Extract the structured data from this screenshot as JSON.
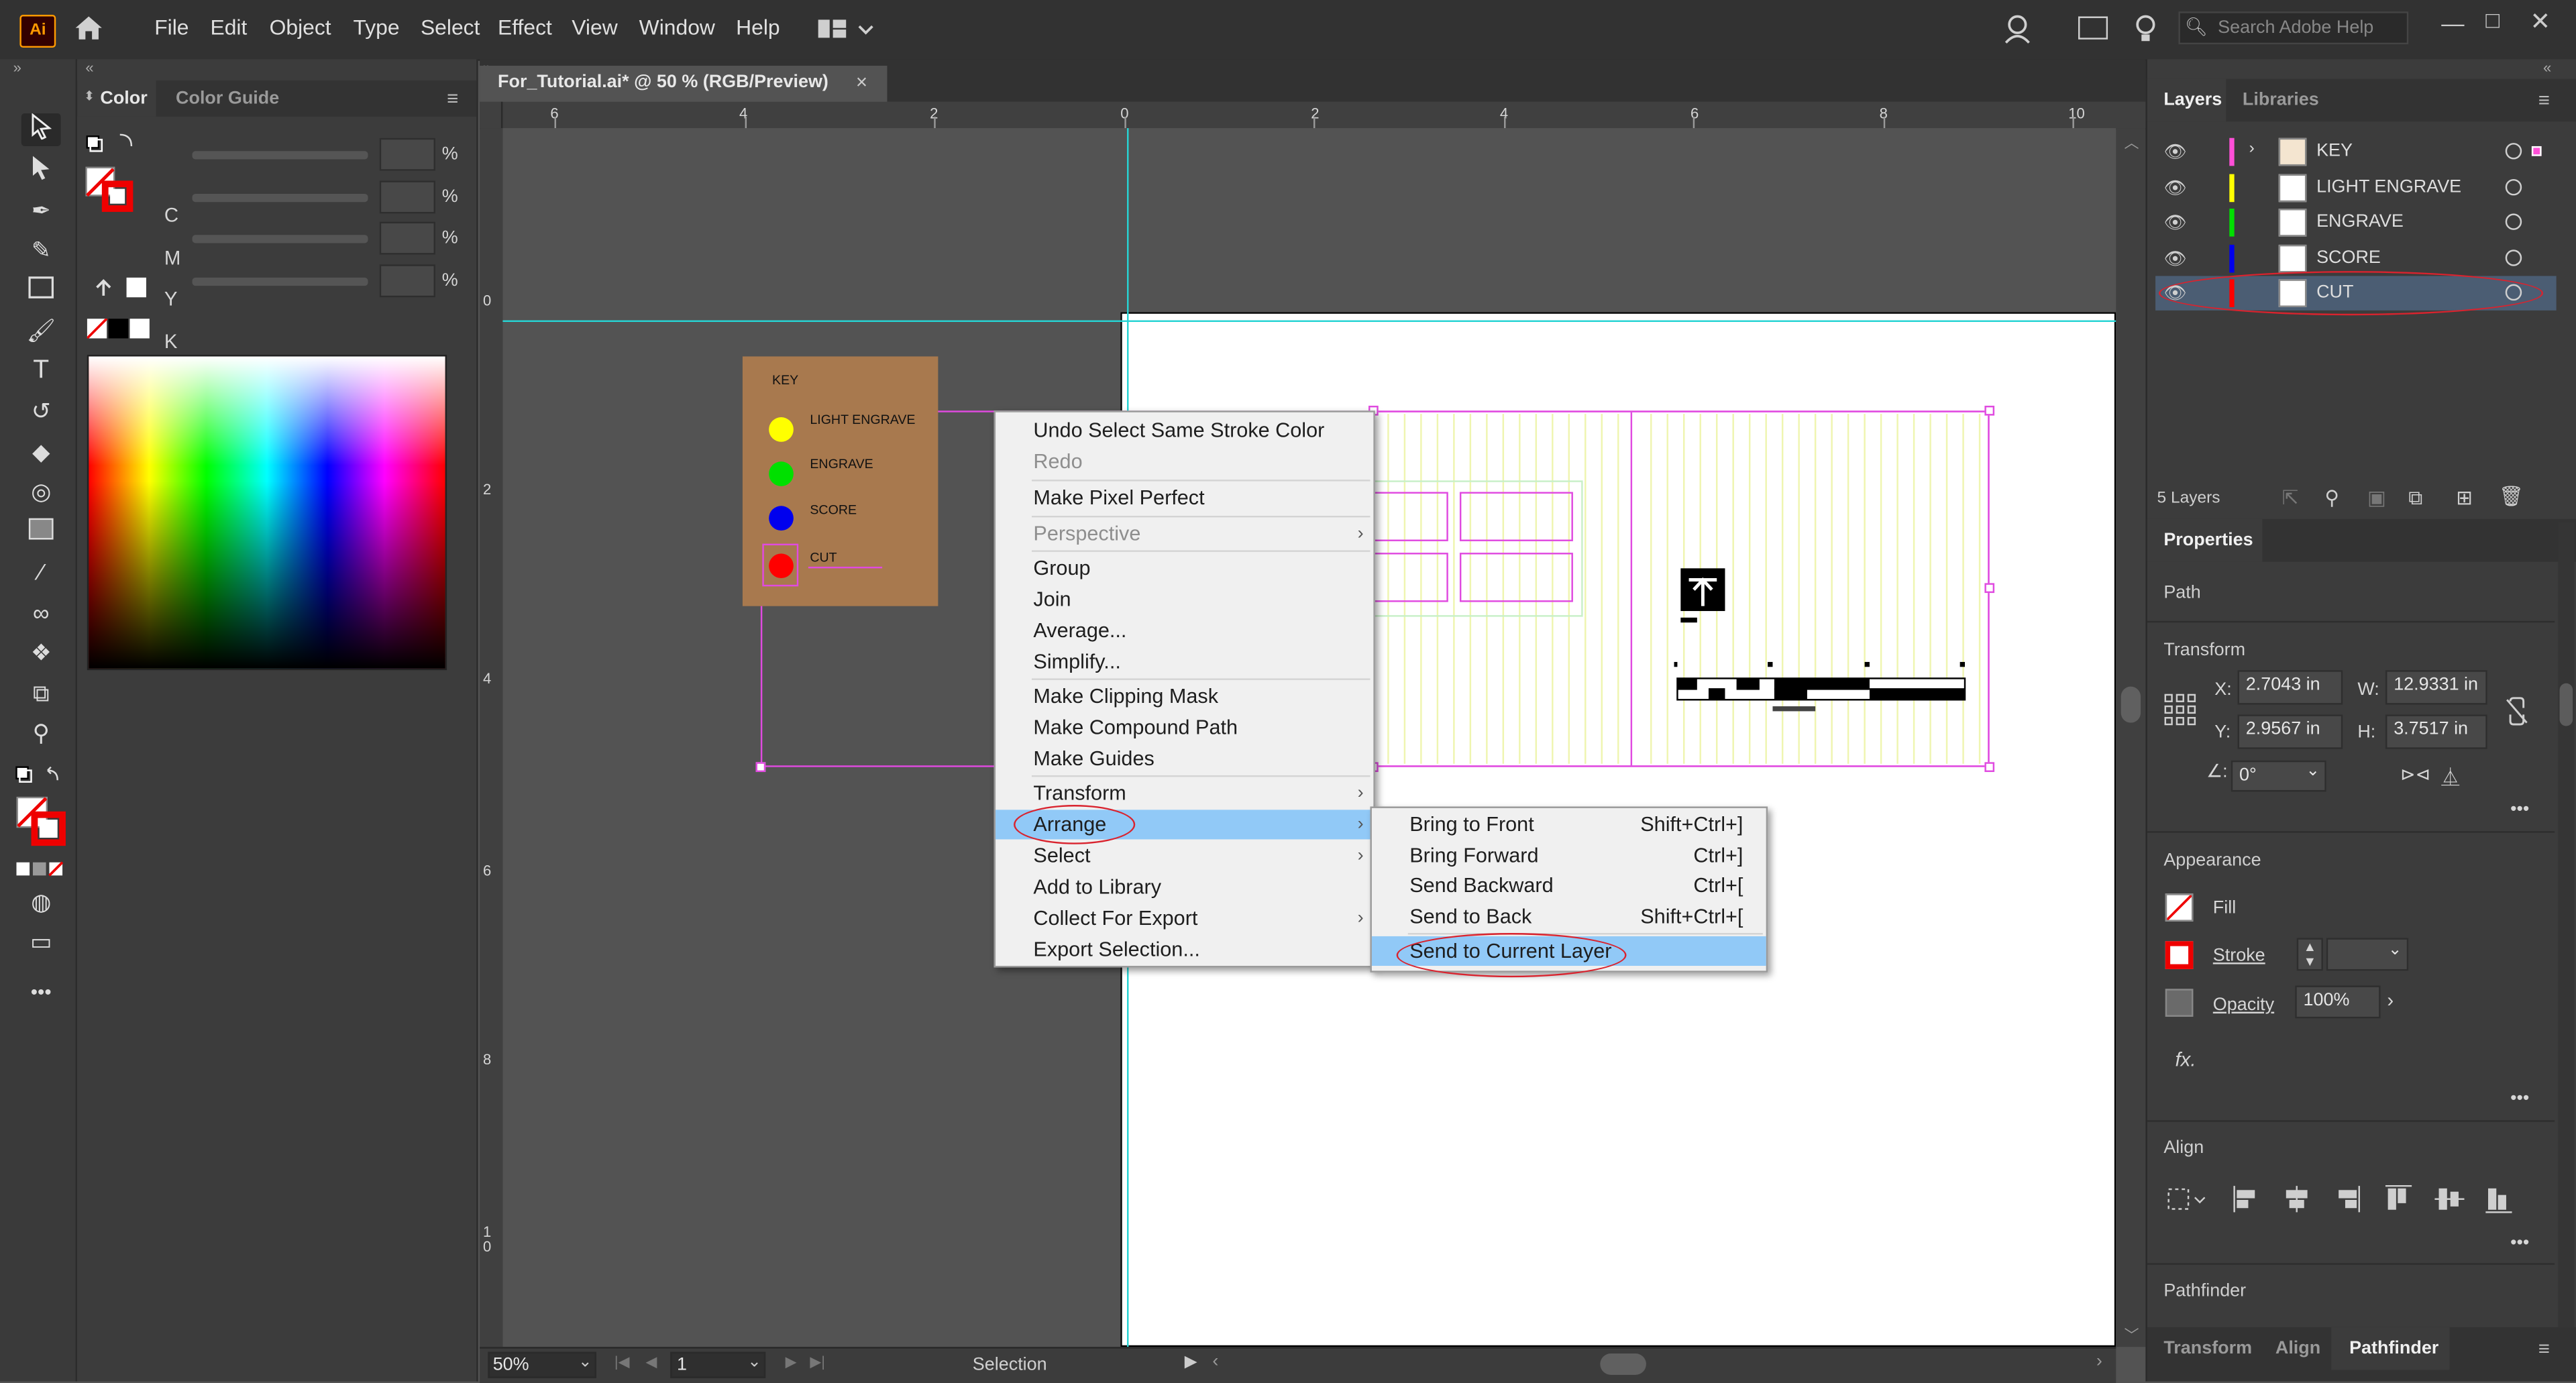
{
  "app": {
    "logo": "Ai",
    "icons": [
      "home-icon",
      "workspace-icon",
      "profile-icon",
      "panel-icon",
      "lightbulb-icon"
    ]
  },
  "menu": [
    "File",
    "Edit",
    "Object",
    "Type",
    "Select",
    "Effect",
    "View",
    "Window",
    "Help"
  ],
  "search": {
    "placeholder": "Search Adobe Help"
  },
  "document_tab": {
    "title": "For_Tutorial.ai* @ 50 % (RGB/Preview)",
    "close": "×"
  },
  "color_panel": {
    "tabs": [
      "Color",
      "Color Guide"
    ],
    "channels": [
      {
        "label": "C",
        "value": "",
        "unit": "%"
      },
      {
        "label": "M",
        "value": "",
        "unit": "%"
      },
      {
        "label": "Y",
        "value": "",
        "unit": "%"
      },
      {
        "label": "K",
        "value": "",
        "unit": "%"
      }
    ]
  },
  "ruler": {
    "horizontal": [
      "6",
      "4",
      "2",
      "0",
      "2",
      "4",
      "6",
      "8",
      "10"
    ],
    "vertical": [
      "0",
      "2",
      "4",
      "6",
      "8",
      "1\n0"
    ]
  },
  "key_panel": {
    "title": "KEY",
    "items": [
      {
        "label": "LIGHT ENGRAVE",
        "color": "#ffff00"
      },
      {
        "label": "ENGRAVE",
        "color": "#00e000"
      },
      {
        "label": "SCORE",
        "color": "#0000ee"
      },
      {
        "label": "CUT",
        "color": "#ff0000"
      }
    ]
  },
  "context_menu": {
    "items": [
      {
        "label": "Undo Select Same Stroke Color",
        "disabled": false
      },
      {
        "label": "Redo",
        "disabled": true
      },
      {
        "label": "Make Pixel Perfect",
        "disabled": false
      },
      {
        "label": "Perspective",
        "disabled": true,
        "submenu": true
      },
      {
        "label": "Group",
        "disabled": false
      },
      {
        "label": "Join",
        "disabled": false
      },
      {
        "label": "Average...",
        "disabled": false
      },
      {
        "label": "Simplify...",
        "disabled": false
      },
      {
        "label": "Make Clipping Mask",
        "disabled": false
      },
      {
        "label": "Make Compound Path",
        "disabled": false
      },
      {
        "label": "Make Guides",
        "disabled": false
      },
      {
        "label": "Transform",
        "disabled": false,
        "submenu": true
      },
      {
        "label": "Arrange",
        "disabled": false,
        "submenu": true,
        "highlighted": true
      },
      {
        "label": "Select",
        "disabled": false,
        "submenu": true
      },
      {
        "label": "Add to Library",
        "disabled": false
      },
      {
        "label": "Collect For Export",
        "disabled": false,
        "submenu": true
      },
      {
        "label": "Export Selection...",
        "disabled": false
      }
    ]
  },
  "arrange_submenu": {
    "items": [
      {
        "label": "Bring to Front",
        "shortcut": "Shift+Ctrl+]"
      },
      {
        "label": "Bring Forward",
        "shortcut": "Ctrl+]"
      },
      {
        "label": "Send Backward",
        "shortcut": "Ctrl+["
      },
      {
        "label": "Send to Back",
        "shortcut": "Shift+Ctrl+["
      },
      {
        "label": "Send to Current Layer",
        "shortcut": "",
        "highlighted": true
      }
    ]
  },
  "layers_panel": {
    "tabs": [
      "Layers",
      "Libraries"
    ],
    "layers": [
      {
        "name": "KEY",
        "color": "#ff4fd8",
        "expanded": true
      },
      {
        "name": "LIGHT ENGRAVE",
        "color": "#ffff00"
      },
      {
        "name": "ENGRAVE",
        "color": "#00e000"
      },
      {
        "name": "SCORE",
        "color": "#0000ee"
      },
      {
        "name": "CUT",
        "color": "#ff0000",
        "selected": true
      }
    ],
    "count": "5 Layers"
  },
  "properties_panel": {
    "tab": "Properties",
    "object_type": "Path",
    "transform": {
      "title": "Transform",
      "x_label": "X:",
      "x": "2.7043 in",
      "y_label": "Y:",
      "y": "2.9567 in",
      "w_label": "W:",
      "w": "12.9331 in",
      "h_label": "H:",
      "h": "3.7517 in",
      "angle": "0°"
    },
    "appearance": {
      "title": "Appearance",
      "fill": "Fill",
      "stroke": "Stroke",
      "opacity_label": "Opacity",
      "opacity": "100%",
      "fx": "fx."
    },
    "align": {
      "title": "Align"
    },
    "pathfinder": {
      "title": "Pathfinder"
    }
  },
  "bottom_tabs": [
    "Transform",
    "Align",
    "Pathfinder"
  ],
  "status_bar": {
    "zoom": "50%",
    "artboard": "1",
    "tool": "Selection"
  }
}
